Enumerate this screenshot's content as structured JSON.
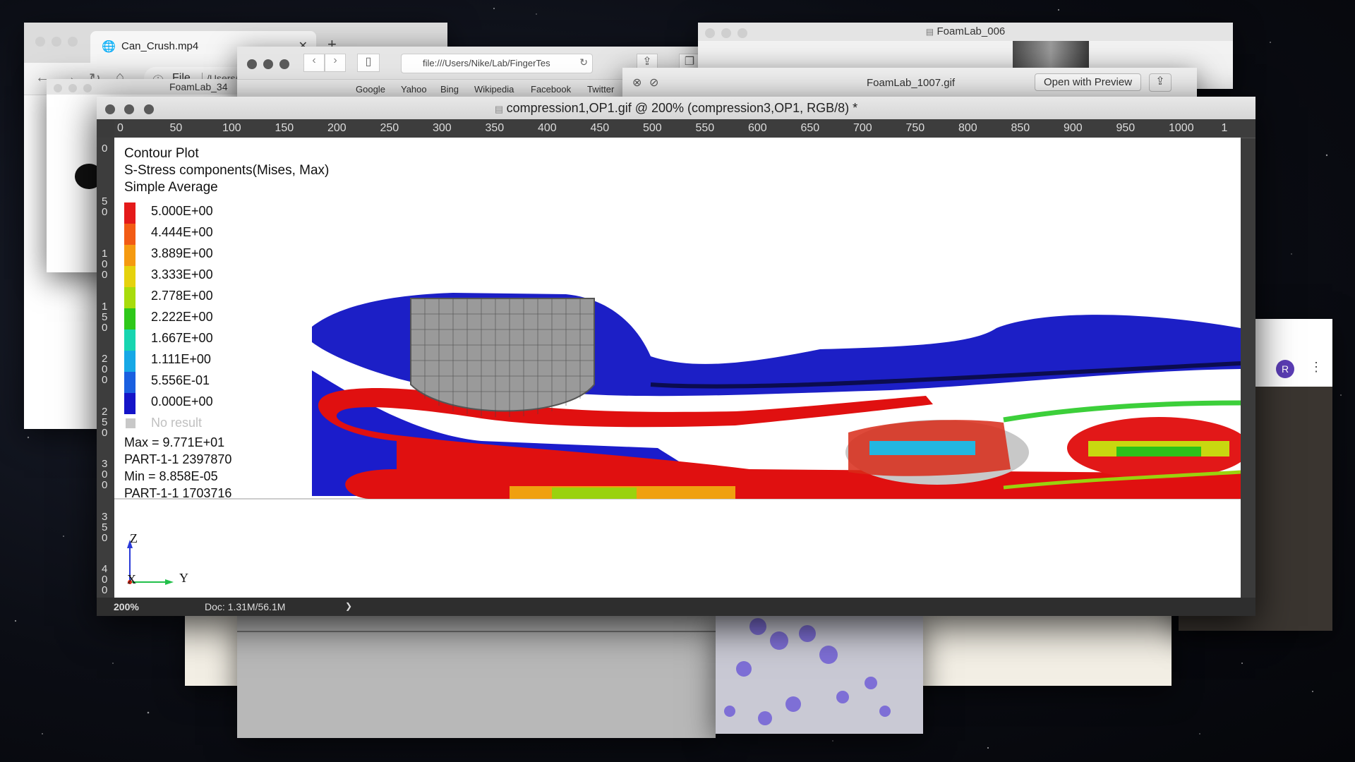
{
  "background_windows": {
    "chrome": {
      "tab_title": "Can_Crush.mp4",
      "address_scheme": "File",
      "address_path": "/Users/",
      "sub_tab": "FoamLab_34"
    },
    "safari": {
      "address": "file:///Users/Nike/Lab/FingerTes",
      "favorites": [
        "Google",
        "Yahoo",
        "Bing",
        "Wikipedia",
        "Facebook",
        "Twitter"
      ]
    },
    "foamlab006": {
      "title": "FoamLab_006"
    },
    "preview": {
      "title": "FoamLab_1007.gif",
      "open_button": "Open with Preview"
    },
    "right_window": {
      "avatar_letter": "R"
    }
  },
  "photoshop": {
    "title": "compression1,OP1.gif @ 200% (compression3,OP1, RGB/8) *",
    "hruler_ticks": [
      "0",
      "50",
      "100",
      "150",
      "200",
      "250",
      "300",
      "350",
      "400",
      "450",
      "500",
      "550",
      "600",
      "650",
      "700",
      "750",
      "800",
      "850",
      "900",
      "950",
      "1000",
      "1"
    ],
    "vruler_ticks": [
      "0",
      "5\n0",
      "1\n0\n0",
      "1\n5\n0",
      "2\n0\n0",
      "2\n5\n0",
      "3\n0\n0",
      "3\n5\n0",
      "4\n0\n0"
    ],
    "status": {
      "zoom": "200%",
      "doc": "Doc: 1.31M/56.1M",
      "arrow": "❯"
    }
  },
  "contour": {
    "title": "Contour Plot",
    "variable": "S-Stress components(Mises, Max)",
    "averaging": "Simple Average",
    "legend": [
      {
        "label": "5.000E+00",
        "color": "#e41a1a"
      },
      {
        "label": "4.444E+00",
        "color": "#f25b14"
      },
      {
        "label": "3.889E+00",
        "color": "#f59a10"
      },
      {
        "label": "3.333E+00",
        "color": "#e5d20d"
      },
      {
        "label": "2.778E+00",
        "color": "#a8dc0c"
      },
      {
        "label": "2.222E+00",
        "color": "#2ec81a"
      },
      {
        "label": "1.667E+00",
        "color": "#17d5b0"
      },
      {
        "label": "1.111E+00",
        "color": "#16a8e6"
      },
      {
        "label": "5.556E-01",
        "color": "#1a5fe0"
      },
      {
        "label": "0.000E+00",
        "color": "#1414c8"
      }
    ],
    "no_result": "No result",
    "max_label": "Max = 9.771E+01",
    "max_part": "PART-1-1 2397870",
    "min_label": "Min = 8.858E-05",
    "min_part": "PART-1-1 1703716",
    "axes": {
      "z": "Z",
      "x": "X",
      "y": "Y"
    }
  }
}
